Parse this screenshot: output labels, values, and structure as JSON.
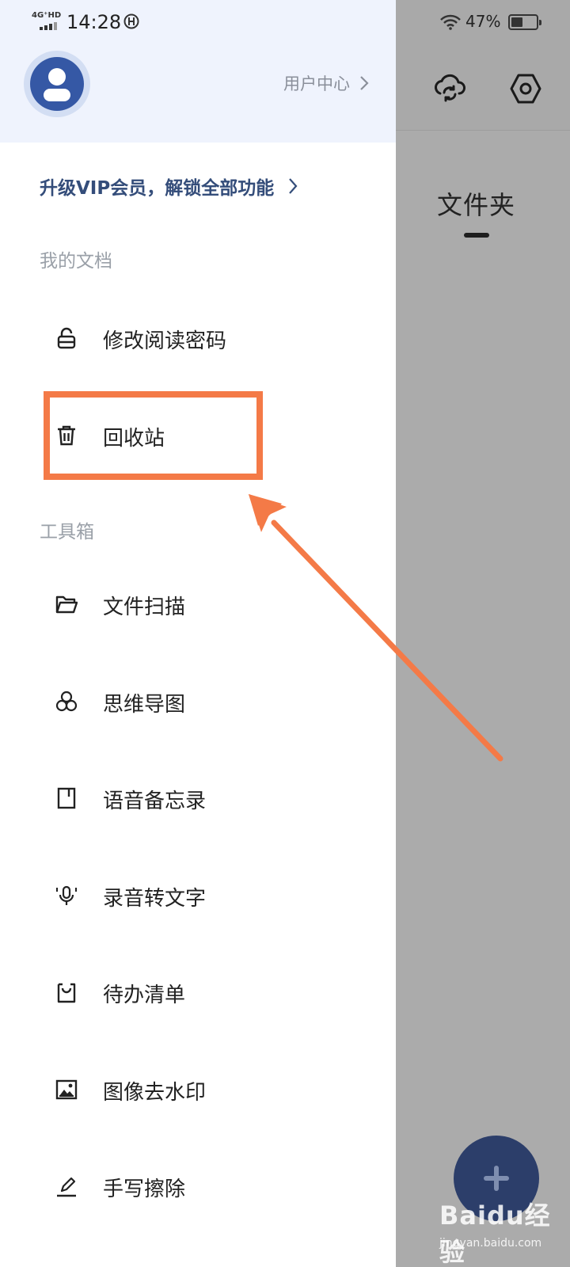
{
  "status_bar": {
    "network": "4G⁺HD",
    "time": "14:28",
    "battery_percent": "47%",
    "battery_level": 0.47
  },
  "drawer": {
    "user_center": "用户中心",
    "vip_banner": "升级VIP会员，解锁全部功能",
    "sections": {
      "docs": {
        "title": "我的文档",
        "items": [
          {
            "label": "修改阅读密码",
            "icon": "lock-icon"
          },
          {
            "label": "回收站",
            "icon": "trash-icon"
          }
        ]
      },
      "tools": {
        "title": "工具箱",
        "items": [
          {
            "label": "文件扫描",
            "icon": "folder-open-icon"
          },
          {
            "label": "思维导图",
            "icon": "mindmap-icon"
          },
          {
            "label": "语音备忘录",
            "icon": "notebook-icon"
          },
          {
            "label": "录音转文字",
            "icon": "microphone-icon"
          },
          {
            "label": "待办清单",
            "icon": "checklist-bag-icon"
          },
          {
            "label": "图像去水印",
            "icon": "image-icon"
          },
          {
            "label": "手写擦除",
            "icon": "pen-icon"
          }
        ]
      }
    }
  },
  "background_app": {
    "folder_tab": "文件夹"
  },
  "watermark": {
    "logo": "Baidu经验",
    "url": "jingyan.baidu.com"
  },
  "colors": {
    "accent": "#3558a5",
    "annotation": "#f47a47",
    "header_bg": "#eff3fd",
    "fab": "#2c3e6a"
  }
}
